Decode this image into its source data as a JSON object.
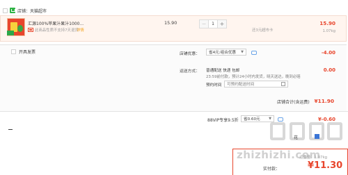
{
  "store": {
    "label": "店铺：天猫超市"
  },
  "product": {
    "title": "汇源100%苹果汁果汁1000...",
    "refund_note": "此商品性质不支持7天退货",
    "refund_link": "详情",
    "unit_price": "15.90",
    "quantity": "1",
    "minus_label": "−",
    "plus_label": "+",
    "limit_note": "还3元超市卡",
    "line_total": "15.90",
    "weight": "1.07kg"
  },
  "invoice": {
    "label": "开具发票"
  },
  "coupon": {
    "label": "店铺优惠：",
    "selected": "省4元:组合优惠",
    "amount": "-4.00"
  },
  "shipping": {
    "label": "运送方式：",
    "line1": "普通配送 快递 包邮",
    "line2": "23:59前付款，预计24小时内发货，晓天送达，晚到必赔",
    "time_label": "预约时间",
    "time_placeholder": "可预约配送时间",
    "fee": "0.00"
  },
  "store_total": {
    "label": "店铺合计(含运费)",
    "value": "¥11.90"
  },
  "vip": {
    "label": "88VIP专享9.5折",
    "selected": "省0.60元",
    "amount": "¥-0.60"
  },
  "payment": {
    "check_label": "花",
    "weight": "运重量：1.07kg",
    "final_label": "实付款：",
    "final_amount": "¥11.30"
  },
  "watermark": {
    "text": "zhizhizhi.com"
  },
  "colors": {
    "accent": "#e8452c",
    "brand_green": "#2eb345",
    "link_blue": "#3b75d6"
  },
  "icons": [
    "store-icon",
    "refund-tag-icon",
    "chat-icon",
    "calendar-icon",
    "checkbox-icon"
  ]
}
